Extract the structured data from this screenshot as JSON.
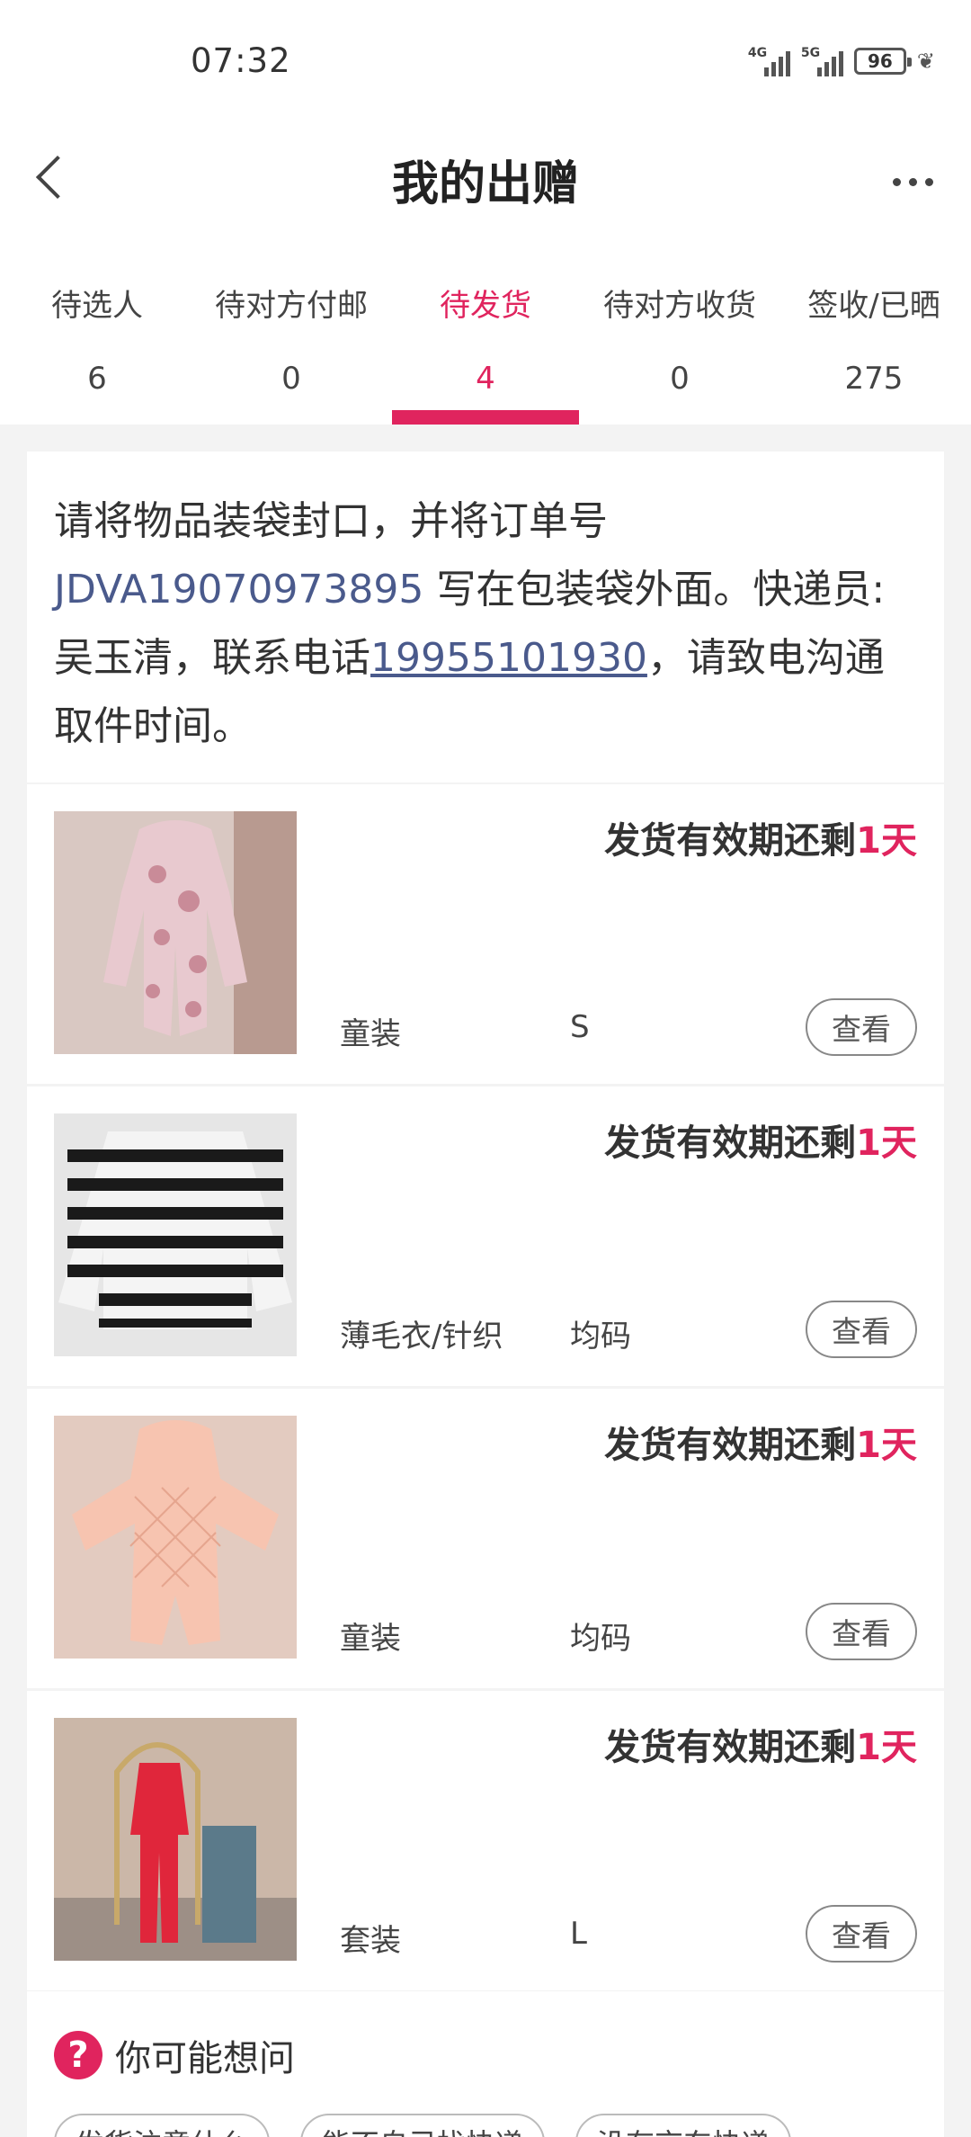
{
  "status_bar": {
    "time": "07:32",
    "signal1_tag": "4G",
    "signal2_tag": "5G",
    "battery": "96"
  },
  "header": {
    "title": "我的出赠"
  },
  "tabs": [
    {
      "label": "待选人",
      "count": "6"
    },
    {
      "label": "待对方付邮",
      "count": "0"
    },
    {
      "label": "待发货",
      "count": "4"
    },
    {
      "label": "待对方收货",
      "count": "0"
    },
    {
      "label": "签收/已晒",
      "count": "275"
    }
  ],
  "notice": {
    "text_before": "请将物品装袋封口，并将订单号 ",
    "order_number": "JDVA19070973895",
    "text_middle": " 写在包装袋外面。快递员:吴玉清，联系电话",
    "phone": "19955101930",
    "text_after": "，请致电沟通取件时间。"
  },
  "items": [
    {
      "deadline_prefix": "发货有效期还剩",
      "deadline_days": "1天",
      "category": "童装",
      "size": "S",
      "view_label": "查看"
    },
    {
      "deadline_prefix": "发货有效期还剩",
      "deadline_days": "1天",
      "category": "薄毛衣/针织",
      "size": "均码",
      "view_label": "查看"
    },
    {
      "deadline_prefix": "发货有效期还剩",
      "deadline_days": "1天",
      "category": "童装",
      "size": "均码",
      "view_label": "查看"
    },
    {
      "deadline_prefix": "发货有效期还剩",
      "deadline_days": "1天",
      "category": "套装",
      "size": "L",
      "view_label": "查看"
    }
  ],
  "faq": {
    "icon": "?",
    "title": "你可能想问",
    "chips": [
      "发货注意什么",
      "能不自己找快递",
      "没有京东快递"
    ]
  },
  "colors": {
    "accent": "#e0245e",
    "link": "#4a5a8c"
  }
}
